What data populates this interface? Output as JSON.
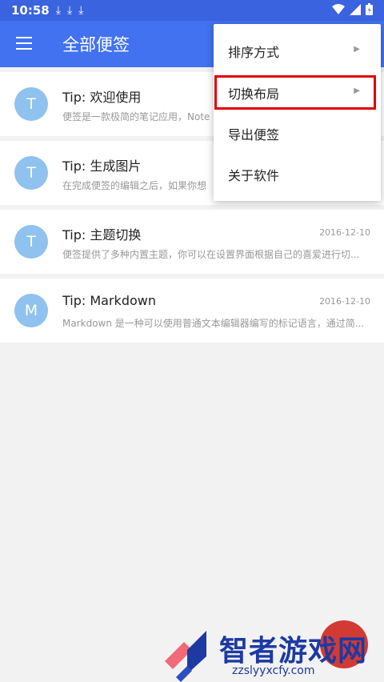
{
  "status_bar": {
    "time": "10:58",
    "download_icons": [
      "⤓",
      "⤓",
      "⤓"
    ]
  },
  "app_bar": {
    "title": "全部便签"
  },
  "notes": [
    {
      "avatar": "T",
      "title": "Tip: 欢迎使用",
      "date": "",
      "desc": "便签是一款极简的笔记应用，Note"
    },
    {
      "avatar": "T",
      "title": "Tip: 生成图片",
      "date": "",
      "desc": "在完成便签的编辑之后，如果你想"
    },
    {
      "avatar": "T",
      "title": "Tip: 主题切换",
      "date": "2016-12-10",
      "desc": "便签提供了多种内置主题，你可以在设置界面根据自己的喜爱进行切..."
    },
    {
      "avatar": "M",
      "title": "Tip: Markdown",
      "date": "2016-12-10",
      "desc": "Markdown 是一种可以使用普通文本编辑器编写的标记语言，通过简..."
    }
  ],
  "menu": {
    "items": [
      {
        "label": "排序方式",
        "has_submenu": true
      },
      {
        "label": "切换布局",
        "has_submenu": true
      },
      {
        "label": "导出便签",
        "has_submenu": false
      },
      {
        "label": "关于软件",
        "has_submenu": false
      }
    ],
    "arrow_glyph": "▶"
  },
  "watermark": {
    "name": "智者游戏网",
    "url": "zzslyyxcfy.com"
  },
  "colors": {
    "primary": "#4272f0",
    "status": "#3a63e0",
    "avatar": "#8fc2ee",
    "highlight": "#e00000",
    "fab": "#d23a34"
  }
}
